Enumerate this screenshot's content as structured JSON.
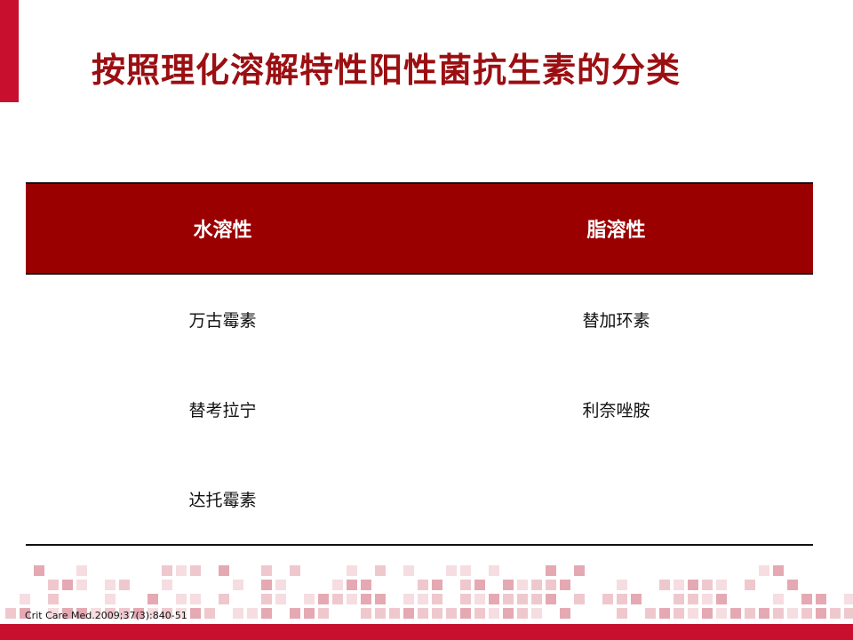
{
  "slide": {
    "title": "按照理化溶解特性阳性菌抗生素的分类",
    "citation": "Crit Care Med.2009;37(3):840-51",
    "accent_color": "#c8102e",
    "header_color": "#9b0000"
  },
  "table": {
    "headers": [
      "水溶性",
      "脂溶性"
    ],
    "rows": [
      [
        "万古霉素",
        "替加环素"
      ],
      [
        "替考拉宁",
        "利奈唑胺"
      ],
      [
        "达托霉素",
        ""
      ]
    ]
  }
}
